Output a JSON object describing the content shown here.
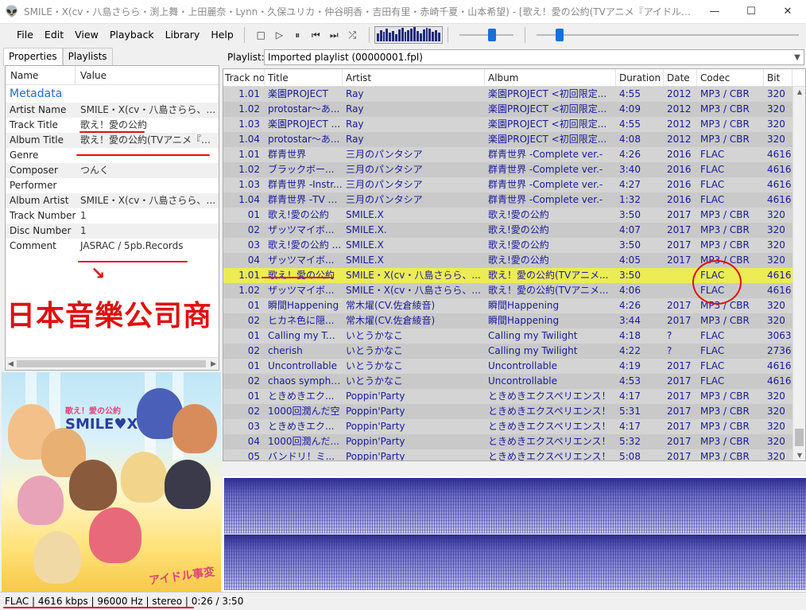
{
  "window": {
    "title": "SMILE・X(cv・八島さらら・渕上舞・上田麗奈・Lynn・久保ユリカ・仲谷明香・吉田有里・赤崎千夏・山本希望) - [歌え！愛の公約(TVアニメ『アイドル事...",
    "icon": "alien-icon",
    "min": "—",
    "max": "☐",
    "close": "✕"
  },
  "menu": [
    "File",
    "Edit",
    "View",
    "Playback",
    "Library",
    "Help"
  ],
  "toolbar": {
    "stop": "□",
    "play": "▷",
    "pause": "⏸",
    "prev": "⏮",
    "next": "⏭",
    "random": "⤮",
    "volume_level": 0.62,
    "seek_level": 0.074
  },
  "visualizer": [
    10,
    14,
    12,
    16,
    11,
    13,
    9,
    15,
    17,
    12,
    14,
    16,
    18,
    13,
    10,
    15,
    17,
    16,
    12,
    14,
    11
  ],
  "left_tabs": [
    "Properties",
    "Playlists"
  ],
  "properties": {
    "col_name": "Name",
    "col_value": "Value",
    "group": "Metadata",
    "rows": [
      {
        "k": "Artist Name",
        "v": "SMILE・X(cv・八島さらら、渕上舞..."
      },
      {
        "k": "Track Title",
        "v": "歌え！愛の公約"
      },
      {
        "k": "Album Title",
        "v": "歌え！愛の公約(TVアニメ『アイ..."
      },
      {
        "k": "Genre",
        "v": ""
      },
      {
        "k": "Composer",
        "v": "つんく"
      },
      {
        "k": "Performer",
        "v": ""
      },
      {
        "k": "Album Artist",
        "v": "SMILE・X(cv・八島さらら、渕上..."
      },
      {
        "k": "Track Number",
        "v": "1"
      },
      {
        "k": "Disc Number",
        "v": "1"
      },
      {
        "k": "Comment",
        "v": "JASRAC / 5pb.Records"
      }
    ]
  },
  "annotation": {
    "arrow": "↘",
    "text": "日本音樂公司商"
  },
  "album_art": {
    "logo_top": "歌え！愛の公約",
    "logo": "SMILE♥X",
    "brand": "アイドル事変"
  },
  "playlist": {
    "label": "Playlist:",
    "selected": "Imported playlist (00000001.fpl)",
    "columns": [
      "Track no",
      "Title",
      "Artist",
      "Album",
      "Duration",
      "Date",
      "Codec",
      "Bit"
    ],
    "rows": [
      {
        "no": "1.01",
        "title": "楽園PROJECT",
        "artist": "Ray",
        "album": "楽園PROJECT <初回限定...",
        "dur": "4:55",
        "date": "2012",
        "codec": "MP3 / CBR",
        "bit": "320"
      },
      {
        "no": "1.02",
        "title": "protostar～あ...",
        "artist": "Ray",
        "album": "楽園PROJECT <初回限定...",
        "dur": "4:09",
        "date": "2012",
        "codec": "MP3 / CBR",
        "bit": "320"
      },
      {
        "no": "1.03",
        "title": "楽園PROJECT ...",
        "artist": "Ray",
        "album": "楽園PROJECT <初回限定...",
        "dur": "4:55",
        "date": "2012",
        "codec": "MP3 / CBR",
        "bit": "320"
      },
      {
        "no": "1.04",
        "title": "protostar～あ...",
        "artist": "Ray",
        "album": "楽園PROJECT <初回限定...",
        "dur": "4:08",
        "date": "2012",
        "codec": "MP3 / CBR",
        "bit": "320"
      },
      {
        "no": "1.01",
        "title": "群青世界",
        "artist": "三月のパンタシア",
        "album": "群青世界 -Complete ver.-",
        "dur": "4:26",
        "date": "2016",
        "codec": "FLAC",
        "bit": "4616"
      },
      {
        "no": "1.02",
        "title": "ブラックボー...",
        "artist": "三月のパンタシア",
        "album": "群青世界 -Complete ver.-",
        "dur": "3:40",
        "date": "2016",
        "codec": "FLAC",
        "bit": "4616"
      },
      {
        "no": "1.03",
        "title": "群青世界 -Instr...",
        "artist": "三月のパンタシア",
        "album": "群青世界 -Complete ver.-",
        "dur": "4:27",
        "date": "2016",
        "codec": "FLAC",
        "bit": "4616"
      },
      {
        "no": "1.04",
        "title": "群青世界 -TV S...",
        "artist": "三月のパンタシア",
        "album": "群青世界 -Complete ver.-",
        "dur": "1:32",
        "date": "2016",
        "codec": "FLAC",
        "bit": "4616"
      },
      {
        "no": "01",
        "title": "歌え!愛の公約",
        "artist": "SMILE.X",
        "album": "歌え!愛の公約",
        "dur": "3:50",
        "date": "2017",
        "codec": "MP3 / CBR",
        "bit": "320"
      },
      {
        "no": "02",
        "title": "ザッツマイボ...",
        "artist": "SMILE.X.",
        "album": "歌え!愛の公約",
        "dur": "4:07",
        "date": "2017",
        "codec": "MP3 / CBR",
        "bit": "320"
      },
      {
        "no": "03",
        "title": "歌え!愛の公約 ...",
        "artist": "SMILE.X",
        "album": "歌え!愛の公約",
        "dur": "3:50",
        "date": "2017",
        "codec": "MP3 / CBR",
        "bit": "320"
      },
      {
        "no": "04",
        "title": "ザッツマイボ...",
        "artist": "SMILE.X",
        "album": "歌え!愛の公約",
        "dur": "4:05",
        "date": "2017",
        "codec": "MP3 / CBR",
        "bit": "320"
      },
      {
        "no": "1.01",
        "title": "歌え！愛の公約",
        "artist": "SMILE・X(cv・八島さらら、...",
        "album": "歌え！愛の公約(TVアニメ...",
        "dur": "3:50",
        "date": "",
        "codec": "FLAC",
        "bit": "4616"
      },
      {
        "no": "1.02",
        "title": "ザッツマイボ...",
        "artist": "SMILE・X(cv・八島さらら、...",
        "album": "歌え！愛の公約(TVアニメ...",
        "dur": "4:06",
        "date": "",
        "codec": "FLAC",
        "bit": "4616"
      },
      {
        "no": "01",
        "title": "瞬間Happening",
        "artist": "常木燿(CV.佐倉綾音)",
        "album": "瞬間Happening",
        "dur": "4:26",
        "date": "2017",
        "codec": "MP3 / CBR",
        "bit": "320"
      },
      {
        "no": "02",
        "title": "ヒカネ色に隠...",
        "artist": "常木燿(CV.佐倉綾音)",
        "album": "瞬間Happening",
        "dur": "3:44",
        "date": "2017",
        "codec": "MP3 / CBR",
        "bit": "320"
      },
      {
        "no": "01",
        "title": "Calling my Twi...",
        "artist": "いとうかなこ",
        "album": "Calling my Twilight",
        "dur": "4:18",
        "date": "?",
        "codec": "FLAC",
        "bit": "3063"
      },
      {
        "no": "02",
        "title": "cherish",
        "artist": "いとうかなこ",
        "album": "Calling my Twilight",
        "dur": "4:22",
        "date": "?",
        "codec": "FLAC",
        "bit": "2736"
      },
      {
        "no": "01",
        "title": "Uncontrollable",
        "artist": "いとうかなこ",
        "album": "Uncontrollable",
        "dur": "4:19",
        "date": "2017",
        "codec": "FLAC",
        "bit": "4616"
      },
      {
        "no": "02",
        "title": "chaos sympho...",
        "artist": "いとうかなこ",
        "album": "Uncontrollable",
        "dur": "4:53",
        "date": "2017",
        "codec": "FLAC",
        "bit": "4616"
      },
      {
        "no": "01",
        "title": "ときめきエク...",
        "artist": "Poppin'Party",
        "album": "ときめきエクスペリエンス！",
        "dur": "4:17",
        "date": "2017",
        "codec": "MP3 / CBR",
        "bit": "320"
      },
      {
        "no": "02",
        "title": "1000回潤んだ空",
        "artist": "Poppin'Party",
        "album": "ときめきエクスペリエンス！",
        "dur": "5:31",
        "date": "2017",
        "codec": "MP3 / CBR",
        "bit": "320"
      },
      {
        "no": "03",
        "title": "ときめきエク...",
        "artist": "Poppin'Party",
        "album": "ときめきエクスペリエンス！",
        "dur": "4:17",
        "date": "2017",
        "codec": "MP3 / CBR",
        "bit": "320"
      },
      {
        "no": "04",
        "title": "1000回潤んだ...",
        "artist": "Poppin'Party",
        "album": "ときめきエクスペリエンス！",
        "dur": "5:32",
        "date": "2017",
        "codec": "MP3 / CBR",
        "bit": "320"
      },
      {
        "no": "05",
        "title": "バンドリ！ミ...",
        "artist": "Poppin'Party",
        "album": "ときめきエクスペリエンス！",
        "dur": "5:08",
        "date": "2017",
        "codec": "MP3 / CBR",
        "bit": "320"
      }
    ],
    "now_playing_index": 12
  },
  "status": "FLAC | 4616 kbps | 96000 Hz | stereo | 0:26 / 3:50",
  "colors": {
    "accent": "#1a6fd6",
    "now_playing": "#ecec54",
    "annotation": "#e01010",
    "row_text": "#1a1a9a"
  }
}
